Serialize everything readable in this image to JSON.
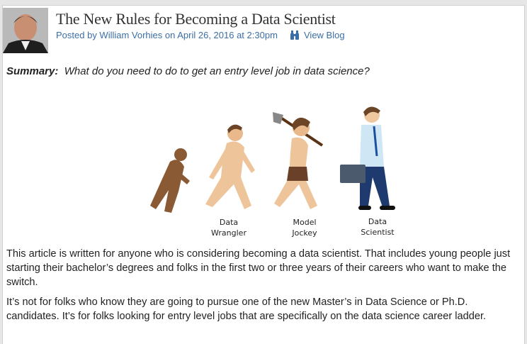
{
  "post": {
    "title": "The New Rules for Becoming a Data Scientist",
    "meta": "Posted by William Vorhies on April 26, 2016 at 2:30pm",
    "view_blog": "View Blog",
    "view_blog_icon": "binoculars-icon",
    "link_color": "#3b6ea5"
  },
  "summary": {
    "label": "Summary:",
    "text": "What do you need to do to get an entry level job in data science?"
  },
  "illustration": {
    "captions": [
      {
        "line1": "Data",
        "line2": "Wrangler"
      },
      {
        "line1": "Model",
        "line2": "Jockey"
      },
      {
        "line1": "Data",
        "line2": "Scientist"
      }
    ]
  },
  "body": {
    "p1": "This article is written for anyone who is considering becoming a data scientist.  That includes young people just starting their bachelor’s degrees and folks in the first two or three years of their careers who want to make the switch.",
    "p2": "It’s not for folks who know they are going to pursue one of the new Master’s in Data Science or Ph.D. candidates.  It’s for folks looking for entry level jobs that are specifically on the data science career ladder."
  }
}
